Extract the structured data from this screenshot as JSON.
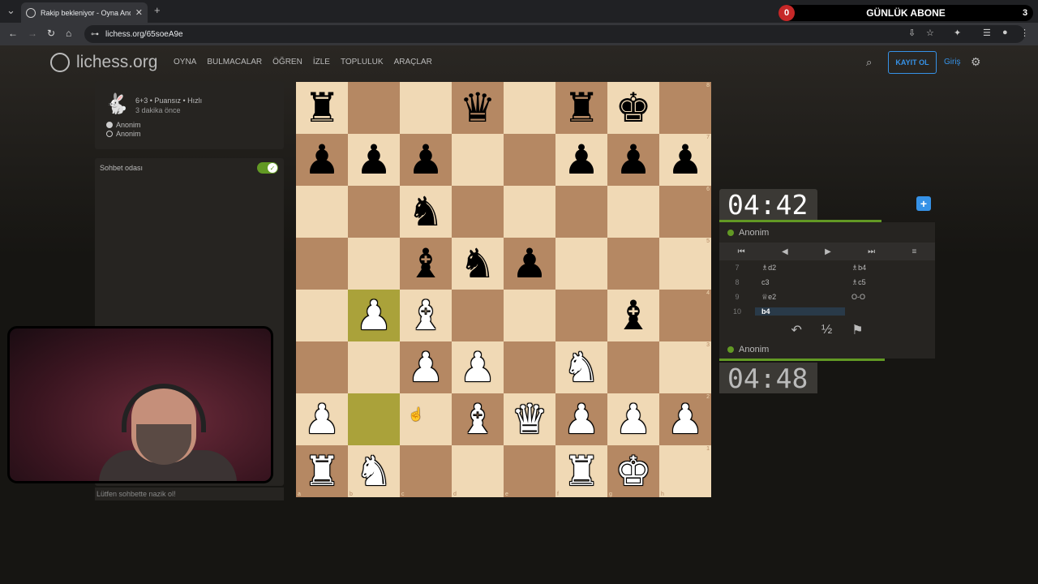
{
  "browser": {
    "tab_title": "Rakip bekleniyor - Oyna Anon...",
    "tab_close": "✕",
    "new_tab": "+",
    "url": "lichess.org/65soeA9e",
    "promo": {
      "left": "0",
      "text": "GÜNLÜK ABONE",
      "right": "3"
    }
  },
  "site": {
    "logo": "lichess.org",
    "menu": [
      "OYNA",
      "BULMACALAR",
      "ÖĞREN",
      "İZLE",
      "TOPLULUK",
      "ARAÇLAR"
    ],
    "signup": "KAYIT OL",
    "login": "Giriş"
  },
  "game": {
    "mode": "6+3 • Puansız • Hızlı",
    "time_ago": "3 dakika önce",
    "players": [
      "Anonim",
      "Anonim"
    ]
  },
  "chat": {
    "title": "Sohbet odası",
    "placeholder": "Lütfen sohbette nazik ol!"
  },
  "board": {
    "rows": [
      [
        "r",
        "",
        "",
        "q",
        "",
        "r",
        "k",
        ""
      ],
      [
        "p",
        "p",
        "p",
        "",
        "",
        "p",
        "p",
        "p"
      ],
      [
        "",
        "",
        "n",
        "",
        "",
        "",
        "",
        ""
      ],
      [
        "",
        "",
        "b",
        "n",
        "p",
        "",
        "",
        ""
      ],
      [
        "",
        "P",
        "B",
        "",
        "",
        "",
        "b",
        ""
      ],
      [
        "",
        "",
        "P",
        "P",
        "",
        "N",
        "",
        ""
      ],
      [
        "P",
        "",
        "",
        "B",
        "Q",
        "P",
        "P",
        "P"
      ],
      [
        "R",
        "N",
        "",
        "",
        "",
        "R",
        "K",
        ""
      ]
    ],
    "highlight": [
      "b4",
      "b2"
    ],
    "files": [
      "a",
      "b",
      "c",
      "d",
      "e",
      "f",
      "g",
      "h"
    ],
    "ranks": [
      "8",
      "7",
      "6",
      "5",
      "4",
      "3",
      "2",
      "1"
    ]
  },
  "clocks": {
    "top": "04:42",
    "bottom": "04:48",
    "top_player": "Anonim",
    "bottom_player": "Anonim"
  },
  "moves": [
    {
      "n": "7",
      "w": "♗d2",
      "b": "♗b4"
    },
    {
      "n": "8",
      "w": "c3",
      "b": "♗c5"
    },
    {
      "n": "9",
      "w": "♕e2",
      "b": "O-O"
    },
    {
      "n": "10",
      "w": "b4",
      "b": ""
    }
  ],
  "icons": {
    "first": "⏮",
    "prev": "◀",
    "next": "▶",
    "last": "⏭",
    "menu": "≡",
    "takeback": "↶",
    "draw": "½",
    "resign": "⚑"
  }
}
